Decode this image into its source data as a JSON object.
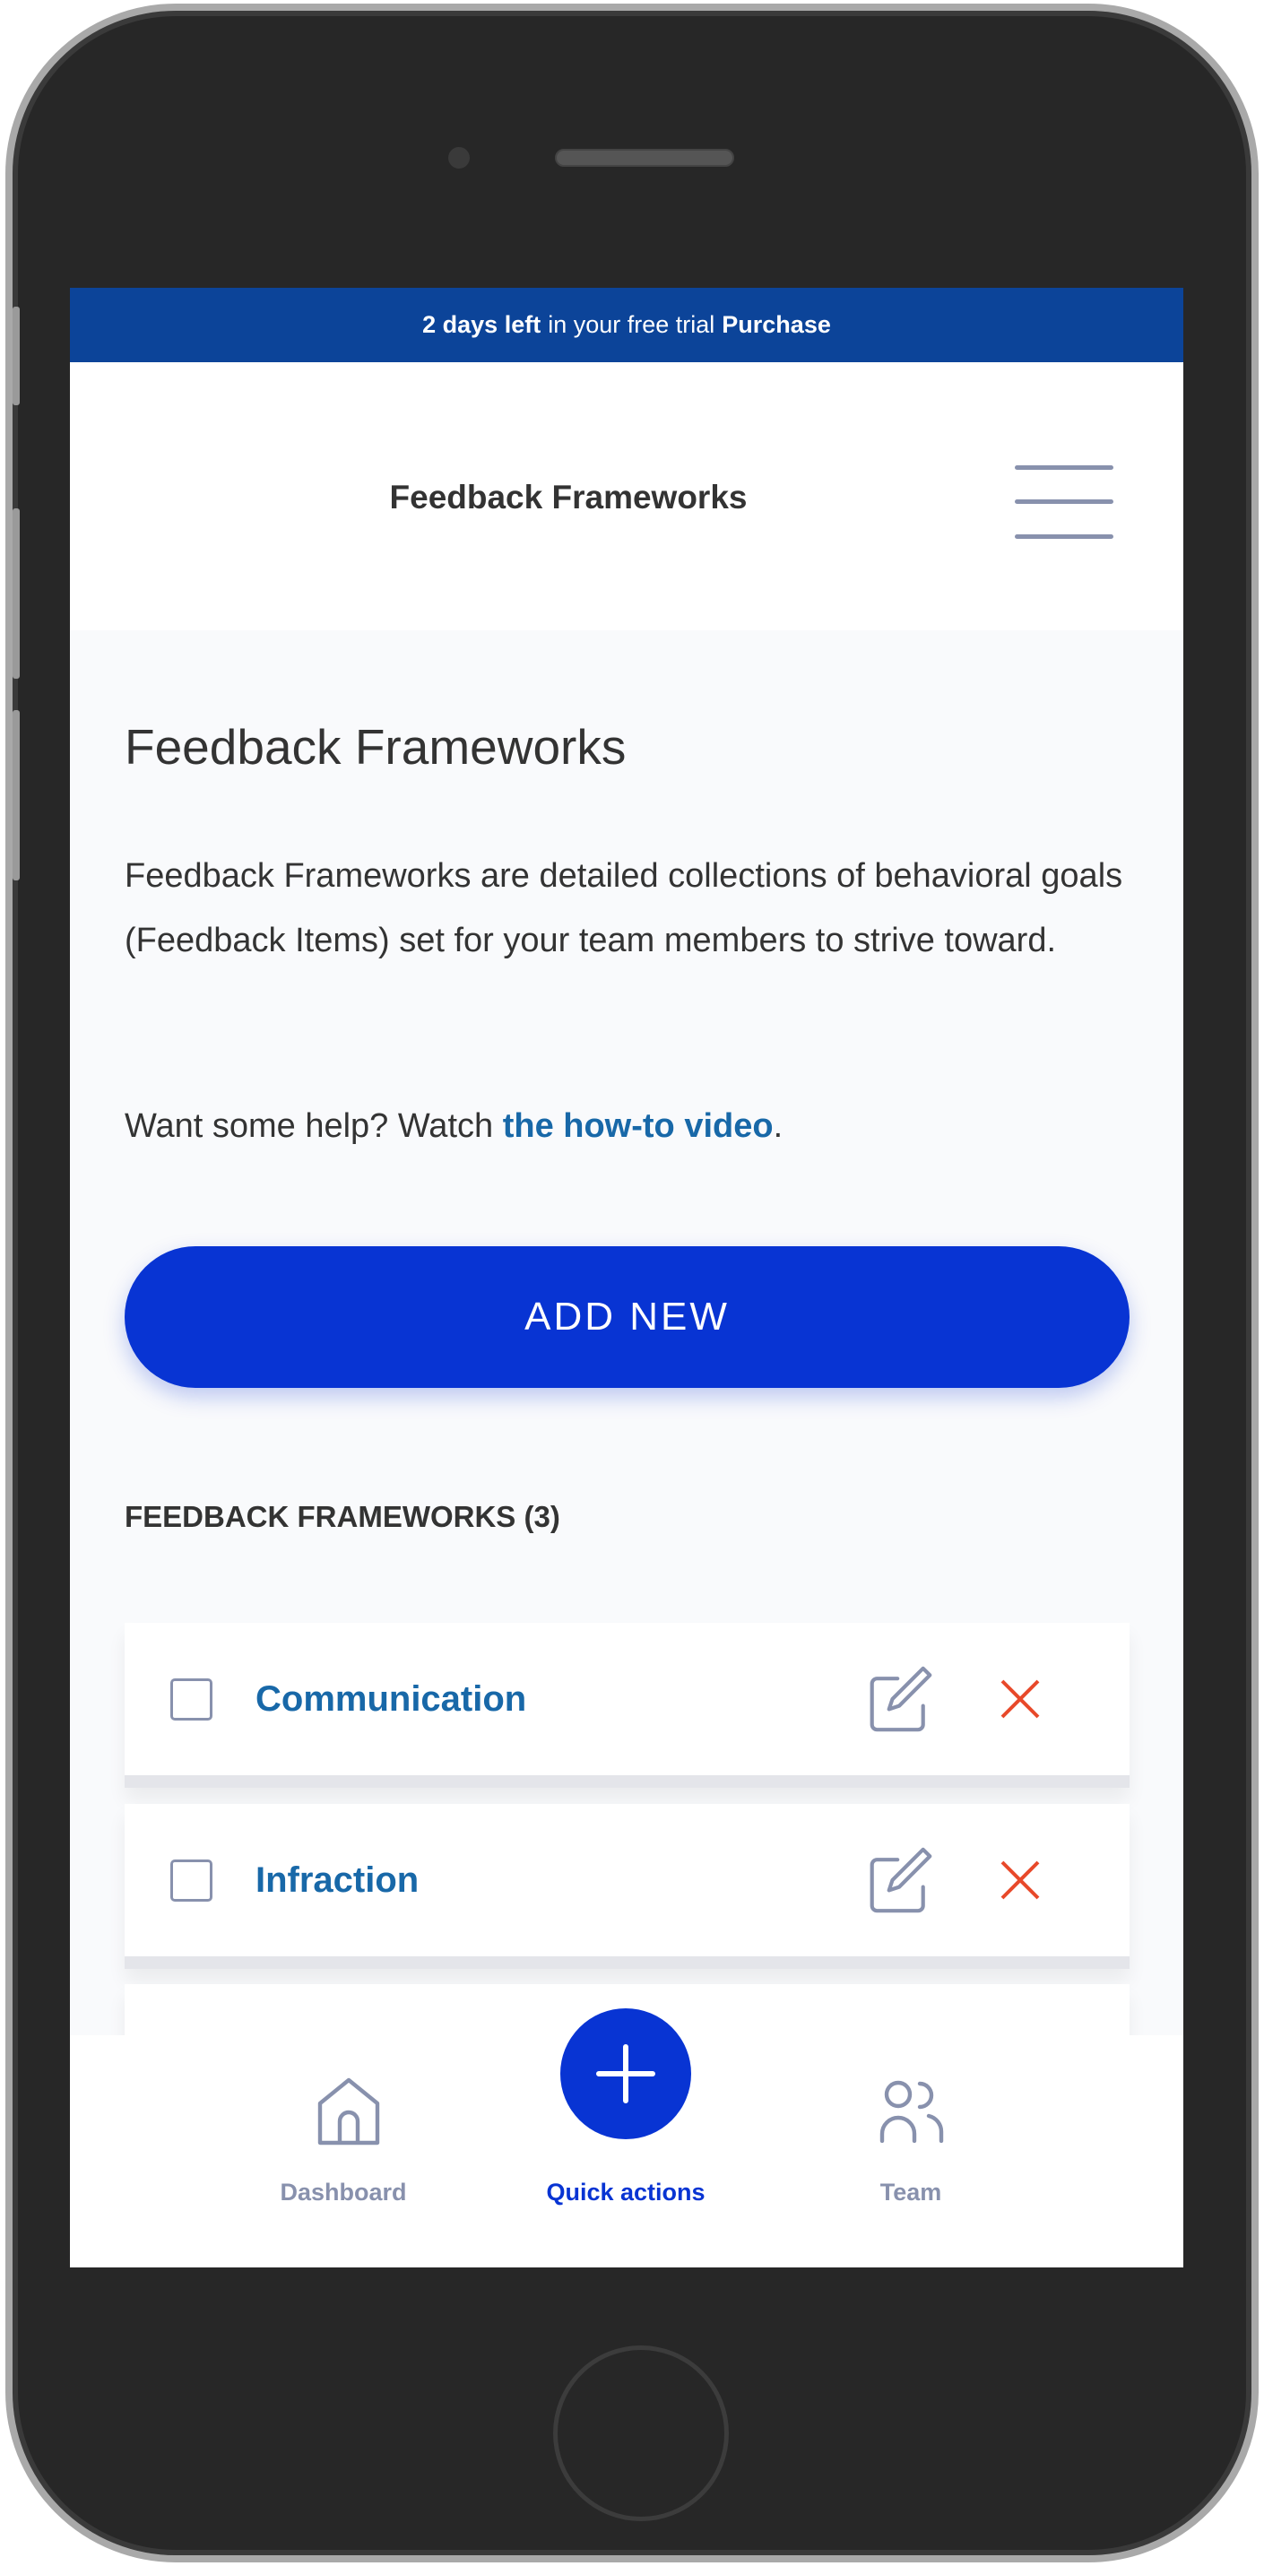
{
  "banner": {
    "days": "2 days left",
    "middle": "in your free trial",
    "purchase": "Purchase"
  },
  "header": {
    "title": "Feedback Frameworks"
  },
  "page": {
    "heading": "Feedback Frameworks",
    "description": "Feedback Frameworks are detailed collections of behavioral goals (Feedback Items) set for your team members to strive toward.",
    "help_prefix": "Want some help? Watch ",
    "help_link": "the how-to video",
    "help_suffix": ".",
    "add_button": "ADD NEW",
    "section_title": "FEEDBACK FRAMEWORKS (3)"
  },
  "frameworks": [
    {
      "name": "Communication"
    },
    {
      "name": "Infraction"
    },
    {
      "name": ""
    }
  ],
  "nav": {
    "dashboard": "Dashboard",
    "quick_actions": "Quick actions",
    "team": "Team"
  },
  "colors": {
    "banner": "#0c4499",
    "primary": "#0834d3",
    "link": "#1868a8",
    "delete": "#e8492a",
    "icon": "#8891ad"
  }
}
